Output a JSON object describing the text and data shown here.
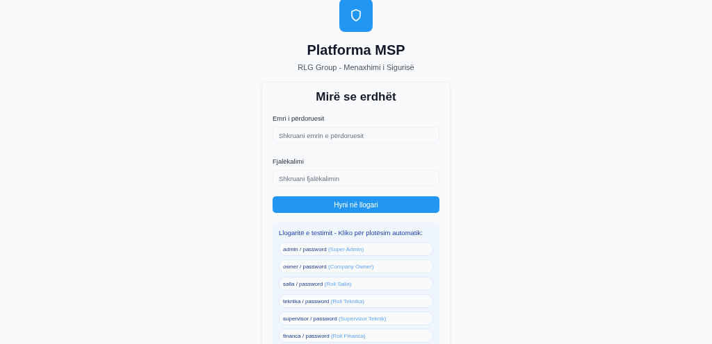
{
  "header": {
    "title": "Platforma MSP",
    "subtitle": "RLG Group - Menaxhimi i Sigurisë"
  },
  "login_card": {
    "heading": "Mirë se erdhët",
    "fields": [
      {
        "label": "Emri i përdoruesit",
        "placeholder": "Shkruani emrin e përdoruesit"
      },
      {
        "label": "Fjalëkalimi",
        "placeholder": "Shkruani fjalëkalimin"
      }
    ],
    "submit_button": "Hyni në llogari",
    "test_accounts": {
      "title": "Llogaritë e testimit - Kliko për plotësim automatik:",
      "items": [
        {
          "credentials": "admin / password",
          "role": "(Super Admin)"
        },
        {
          "credentials": "owner / password",
          "role": "(Company Owner)"
        },
        {
          "credentials": "salla / password",
          "role": "(Roli Salla)"
        },
        {
          "credentials": "teknika / password",
          "role": "(Roli Teknika)"
        },
        {
          "credentials": "supervisor / password",
          "role": "(Supervizor Teknik)"
        },
        {
          "credentials": "financa / password",
          "role": "(Roli Financa)"
        }
      ]
    }
  }
}
